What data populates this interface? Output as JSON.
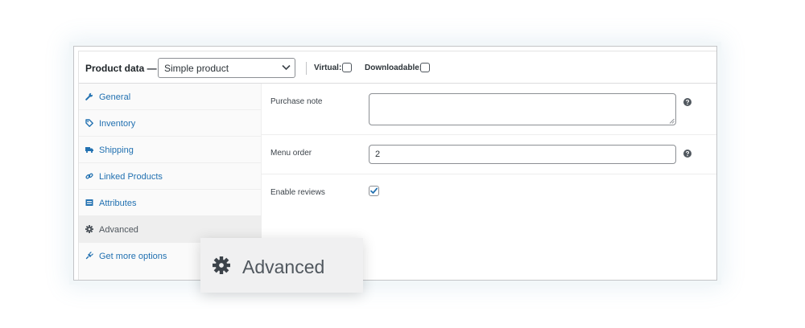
{
  "header": {
    "title": "Product data —",
    "product_type": {
      "selected": "Simple product"
    },
    "virtual_label": "Virtual:",
    "downloadable_label": "Downloadable:"
  },
  "sidebar": {
    "items": [
      {
        "label": "General",
        "icon": "wrench-icon"
      },
      {
        "label": "Inventory",
        "icon": "tag-icon"
      },
      {
        "label": "Shipping",
        "icon": "truck-icon"
      },
      {
        "label": "Linked Products",
        "icon": "link-icon"
      },
      {
        "label": "Attributes",
        "icon": "list-icon"
      },
      {
        "label": "Advanced",
        "icon": "gear-icon",
        "active": true
      },
      {
        "label": "Get more options",
        "icon": "plugin-icon"
      }
    ]
  },
  "main": {
    "purchase_note": {
      "label": "Purchase note",
      "value": ""
    },
    "menu_order": {
      "label": "Menu order",
      "value": "2"
    },
    "enable_reviews": {
      "label": "Enable reviews",
      "checked": true
    }
  },
  "callout": {
    "label": "Advanced",
    "icon": "gear-icon"
  },
  "colors": {
    "link": "#2271b1",
    "active_tab_bg": "#eeeeee",
    "checkbox_check": "#2271b1"
  }
}
